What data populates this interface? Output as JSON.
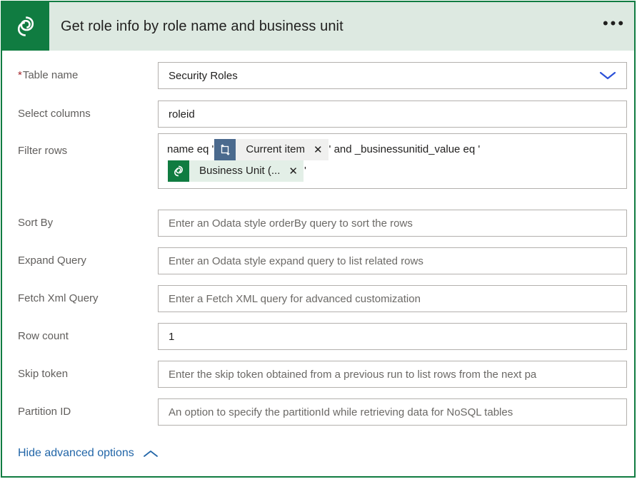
{
  "header": {
    "title": "Get role info by role name and business unit",
    "icon": "dataverse-icon",
    "menu_label": "•••",
    "bg_color": "#dde9e1",
    "icon_bg_color": "#107c41"
  },
  "form": {
    "rows": [
      {
        "label": "Table name",
        "required": true,
        "required_marker": "*",
        "type": "dropdown",
        "value": "Security Roles",
        "placeholder": ""
      },
      {
        "label": "Select columns",
        "required": false,
        "type": "text",
        "value": "roleid",
        "placeholder": ""
      },
      {
        "label": "Filter rows",
        "required": false,
        "type": "tokens",
        "segments": [
          {
            "kind": "text",
            "text": "name eq "
          },
          {
            "kind": "text",
            "text": "'"
          },
          {
            "kind": "chip",
            "label": "Current item",
            "icon": "current-item-icon",
            "icon_color": "#4b6a8e",
            "body_color": "#f0f0ef",
            "close": "✕"
          },
          {
            "kind": "text",
            "text": "'"
          },
          {
            "kind": "text",
            "text": " and _businessunitid_value eq "
          },
          {
            "kind": "text",
            "text": "'"
          },
          {
            "kind": "chip",
            "label": "Business Unit (...",
            "icon": "dataverse-icon",
            "icon_color": "#107c41",
            "body_color": "#e3efe7",
            "close": "✕"
          },
          {
            "kind": "text",
            "text": "'"
          }
        ]
      },
      {
        "label": "Sort By",
        "required": false,
        "type": "text",
        "value": "",
        "placeholder": "Enter an Odata style orderBy query to sort the rows"
      },
      {
        "label": "Expand Query",
        "required": false,
        "type": "text",
        "value": "",
        "placeholder": "Enter an Odata style expand query to list related rows"
      },
      {
        "label": "Fetch Xml Query",
        "required": false,
        "type": "text",
        "value": "",
        "placeholder": "Enter a Fetch XML query for advanced customization"
      },
      {
        "label": "Row count",
        "required": false,
        "type": "text",
        "value": "1",
        "placeholder": ""
      },
      {
        "label": "Skip token",
        "required": false,
        "type": "text",
        "value": "",
        "placeholder": "Enter the skip token obtained from a previous run to list rows from the next pa"
      },
      {
        "label": "Partition ID",
        "required": false,
        "type": "text",
        "value": "",
        "placeholder": "An option to specify the partitionId while retrieving data for NoSQL tables"
      }
    ]
  },
  "advanced": {
    "label": "Hide advanced options",
    "icon": "chevron-up-icon",
    "link_color": "#2266a8"
  },
  "colors": {
    "card_border": "#107c41",
    "field_border": "#b3b0ad",
    "label_text": "#605e5c",
    "value_text": "#201f1e",
    "placeholder_text": "#6b6966",
    "required_star": "#a4262c",
    "dropdown_chevron": "#2b50d8"
  }
}
